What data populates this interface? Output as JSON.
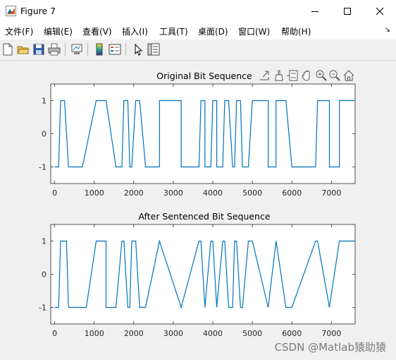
{
  "window": {
    "title": "Figure 7",
    "accent_color": "#0072bd"
  },
  "menubar": {
    "items": [
      {
        "label": "文件(F)"
      },
      {
        "label": "编辑(E)"
      },
      {
        "label": "查看(V)"
      },
      {
        "label": "插入(I)"
      },
      {
        "label": "工具(T)"
      },
      {
        "label": "桌面(D)"
      },
      {
        "label": "窗口(W)"
      },
      {
        "label": "帮助(H)"
      }
    ],
    "overflow_icon": "menu-arrow-icon"
  },
  "toolbar": {
    "buttons": [
      "new-figure-icon",
      "open-file-icon",
      "save-icon",
      "print-icon",
      "link-plot-icon",
      "insert-colorbar-icon",
      "insert-legend-icon",
      "select-pointer-icon",
      "property-inspector-icon"
    ]
  },
  "axes_toolbar": {
    "buttons": [
      "export-icon",
      "brush-icon",
      "data-tips-icon",
      "pan-icon",
      "zoom-in-icon",
      "zoom-out-icon",
      "home-icon"
    ]
  },
  "watermark": "CSDN @Matlab猿助猿",
  "chart_data": [
    {
      "type": "line",
      "title": "Original Bit Sequence",
      "xlim": [
        -100,
        7600
      ],
      "ylim": [
        -1.5,
        1.5
      ],
      "xticks": [
        0,
        1000,
        2000,
        3000,
        4000,
        5000,
        6000,
        7000
      ],
      "yticks": [
        -1,
        0,
        1
      ],
      "grid": false,
      "color": "#0072bd",
      "step_x": [
        0,
        100,
        150,
        250,
        350,
        700,
        1050,
        1300,
        1550,
        1700,
        1750,
        1850,
        1900,
        1950,
        2050,
        2150,
        2300,
        2650,
        2650,
        3200,
        3200,
        3650,
        3700,
        3800,
        3800,
        3950,
        4000,
        4100,
        4100,
        4250,
        4300,
        4400,
        4500,
        4550,
        4600,
        4700,
        4750,
        4900,
        5000,
        5400,
        5400,
        5600,
        5600,
        5850,
        6000,
        6600,
        6650,
        6950,
        6950,
        7200,
        7200,
        7600
      ],
      "step_y": [
        -1,
        -1,
        1,
        1,
        -1,
        -1,
        1,
        1,
        -1,
        -1,
        1,
        1,
        -1,
        -1,
        1,
        1,
        -1,
        -1,
        1,
        1,
        -1,
        -1,
        1,
        1,
        -1,
        -1,
        1,
        1,
        -1,
        -1,
        1,
        1,
        -1,
        -1,
        1,
        1,
        -1,
        -1,
        1,
        1,
        -1,
        -1,
        1,
        1,
        -1,
        -1,
        1,
        1,
        -1,
        -1,
        1,
        1
      ]
    },
    {
      "type": "line",
      "title": "After Sentenced Bit Sequence",
      "xlim": [
        -100,
        7600
      ],
      "ylim": [
        -1.5,
        1.5
      ],
      "xticks": [
        0,
        1000,
        2000,
        3000,
        4000,
        5000,
        6000,
        7000
      ],
      "yticks": [
        -1,
        0,
        1
      ],
      "grid": false,
      "color": "#0072bd",
      "step_x": [
        0,
        100,
        150,
        300,
        350,
        800,
        1050,
        1300,
        1300,
        1550,
        1700,
        1750,
        1850,
        1900,
        1950,
        2050,
        2150,
        2300,
        2650,
        2650,
        3200,
        3200,
        3650,
        3700,
        3800,
        3800,
        3950,
        4000,
        4100,
        4100,
        4250,
        4300,
        4400,
        4500,
        4550,
        4600,
        4700,
        4750,
        4900,
        5000,
        5400,
        5400,
        5600,
        5600,
        5850,
        6000,
        6600,
        6650,
        6950,
        6950,
        7200,
        7200,
        7600
      ],
      "step_y": [
        -1,
        -1,
        1,
        1,
        -1,
        -1,
        1,
        1,
        -1,
        -1,
        1,
        1,
        -1,
        -1,
        1,
        1,
        -1,
        -1,
        1,
        1,
        -1,
        -1,
        1,
        1,
        -1,
        -1,
        1,
        1,
        -1,
        -1,
        1,
        1,
        -1,
        -1,
        1,
        1,
        -1,
        -1,
        1,
        1,
        -1,
        -1,
        1,
        1,
        -1,
        -1,
        1,
        1,
        -1,
        -1,
        1,
        1,
        1
      ]
    }
  ]
}
